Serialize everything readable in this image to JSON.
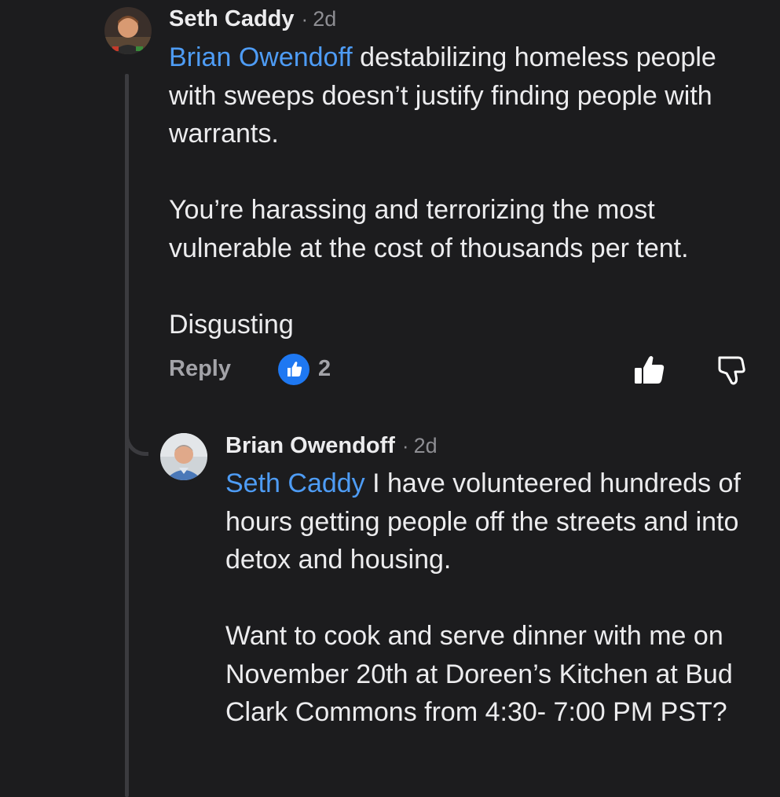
{
  "comments": [
    {
      "author": "Seth Caddy",
      "separator": "·",
      "time": "2d",
      "mention": "Brian Owendoff",
      "text": " destabilizing homeless people with sweeps doesn’t justify finding people with warrants.\n\nYou’re harassing and terrorizing the most vulnerable at the cost of thousands per tent.\n\nDisgusting",
      "reply_label": "Reply",
      "reaction_icon": "thumbs-up-icon",
      "reaction_count": "2",
      "like_icon": "thumbs-up-outline-icon",
      "dislike_icon": "thumbs-down-outline-icon"
    },
    {
      "author": "Brian Owendoff",
      "separator": "·",
      "time": "2d",
      "mention": "Seth Caddy",
      "text": " I have volunteered hundreds of hours getting people off the streets and into detox and housing.\n\nWant to cook and serve dinner with me on November 20th at Doreen’s Kitchen at Bud Clark Commons from 4:30- 7:00 PM PST?"
    }
  ],
  "colors": {
    "background": "#1c1c1e",
    "text": "#ececee",
    "mention": "#4e9cf5",
    "muted": "#8e8e93",
    "reaction_badge": "#1e78f2",
    "thread_line": "#3b3b3f"
  }
}
